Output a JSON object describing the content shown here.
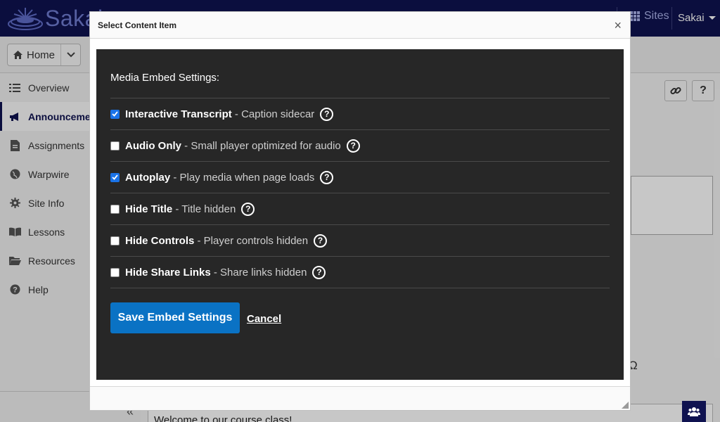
{
  "app": {
    "logo_text": "Sakai",
    "sites_label": "Sites",
    "user_label": "Sakai",
    "home_label": "Home"
  },
  "sidebar": {
    "items": [
      {
        "label": "Overview",
        "icon": "list-icon",
        "active": false
      },
      {
        "label": "Announcements",
        "icon": "megaphone-icon",
        "active": true
      },
      {
        "label": "Assignments",
        "icon": "file-icon",
        "active": false
      },
      {
        "label": "Warpwire",
        "icon": "globe-icon",
        "active": false
      },
      {
        "label": "Site Info",
        "icon": "gear-icon",
        "active": false
      },
      {
        "label": "Lessons",
        "icon": "book-icon",
        "active": false
      },
      {
        "label": "Resources",
        "icon": "folder-icon",
        "active": false
      },
      {
        "label": "Help",
        "icon": "help-icon",
        "active": false
      }
    ]
  },
  "content": {
    "omega_symbol": "Ω",
    "welcome_text": "Welcome to our course class!",
    "help_button_label": "?"
  },
  "dialog": {
    "title": "Select Content Item",
    "close_label": "×",
    "heading": "Media Embed Settings:",
    "options": [
      {
        "name": "Interactive Transcript",
        "description": " - Caption sidecar",
        "checked": true
      },
      {
        "name": "Audio Only",
        "description": " - Small player optimized for audio",
        "checked": false
      },
      {
        "name": "Autoplay",
        "description": " - Play media when page loads",
        "checked": true
      },
      {
        "name": "Hide Title",
        "description": " - Title hidden",
        "checked": false
      },
      {
        "name": "Hide Controls",
        "description": " - Player controls hidden",
        "checked": false
      },
      {
        "name": "Hide Share Links",
        "description": " - Share links hidden",
        "checked": false
      }
    ],
    "help_symbol": "?",
    "save_label": "Save Embed Settings",
    "cancel_label": "Cancel"
  },
  "colors": {
    "topbar": "#0f1250",
    "dark_panel": "#272727",
    "save_button": "#0a72c4",
    "checkbox_checked": "#1a73e8"
  }
}
